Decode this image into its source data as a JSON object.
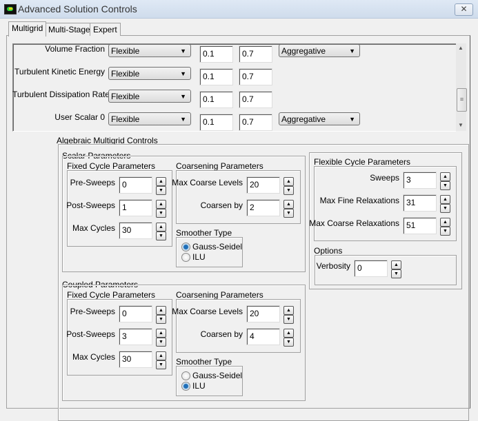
{
  "window": {
    "title": "Advanced Solution Controls",
    "close_icon": "close-icon"
  },
  "tabs": [
    {
      "label": "Multigrid",
      "selected": true
    },
    {
      "label": "Multi-Stage",
      "selected": false
    },
    {
      "label": "Expert",
      "selected": false
    }
  ],
  "equations": [
    {
      "label": "Volume Fraction",
      "cycle": "Flexible",
      "v1": "0.1",
      "v2": "0.7",
      "method": "Aggregative"
    },
    {
      "label": "Turbulent Kinetic Energy",
      "cycle": "Flexible",
      "v1": "0.1",
      "v2": "0.7"
    },
    {
      "label": "Turbulent Dissipation Rate",
      "cycle": "Flexible",
      "v1": "0.1",
      "v2": "0.7"
    },
    {
      "label": "User Scalar 0",
      "cycle": "Flexible",
      "v1": "0.1",
      "v2": "0.7",
      "method": "Aggregative"
    }
  ],
  "amg": {
    "title": "Algebraic Multigrid Controls",
    "scalar": {
      "title": "Scalar Parameters",
      "fixed": {
        "title": "Fixed Cycle Parameters",
        "fields": [
          {
            "label": "Pre-Sweeps",
            "value": "0"
          },
          {
            "label": "Post-Sweeps",
            "value": "1"
          },
          {
            "label": "Max Cycles",
            "value": "30"
          }
        ]
      },
      "coarsening": {
        "title": "Coarsening Parameters",
        "fields": [
          {
            "label": "Max Coarse Levels",
            "value": "20"
          },
          {
            "label": "Coarsen by",
            "value": "2"
          }
        ]
      },
      "smoother": {
        "title": "Smoother Type",
        "options": [
          "Gauss-Seidel",
          "ILU"
        ],
        "selected": "Gauss-Seidel"
      }
    },
    "coupled": {
      "title": "Coupled Parameters",
      "fixed": {
        "title": "Fixed Cycle Parameters",
        "fields": [
          {
            "label": "Pre-Sweeps",
            "value": "0"
          },
          {
            "label": "Post-Sweeps",
            "value": "3"
          },
          {
            "label": "Max Cycles",
            "value": "30"
          }
        ]
      },
      "coarsening": {
        "title": "Coarsening Parameters",
        "fields": [
          {
            "label": "Max Coarse Levels",
            "value": "20"
          },
          {
            "label": "Coarsen by",
            "value": "4"
          }
        ]
      },
      "smoother": {
        "title": "Smoother Type",
        "options": [
          "Gauss-Seidel",
          "ILU"
        ],
        "selected": "ILU"
      }
    },
    "flexible": {
      "title": "Flexible Cycle Parameters",
      "fields": [
        {
          "label": "Sweeps",
          "value": "3"
        },
        {
          "label": "Max Fine Relaxations",
          "value": "31"
        },
        {
          "label": "Max Coarse Relaxations",
          "value": "51"
        }
      ]
    },
    "options": {
      "title": "Options",
      "fields": [
        {
          "label": "Verbosity",
          "value": "0"
        }
      ]
    }
  }
}
